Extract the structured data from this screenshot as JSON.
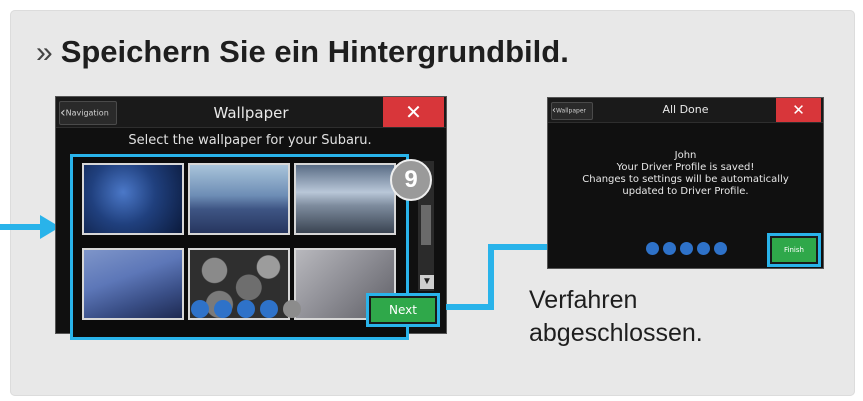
{
  "heading": {
    "chevron": "»",
    "text": "Speichern Sie ein Hintergrundbild."
  },
  "wallpaper_screen": {
    "back_label": "Navigation",
    "title": "Wallpaper",
    "close_label": "✕",
    "subtitle": "Select the wallpaper for your Subaru.",
    "thumbnails": [
      "starry-night",
      "blue-mountains",
      "ocean-rocks",
      "aurora",
      "pebbles",
      "silver-texture"
    ],
    "step_number": "9",
    "scroll_down_icon": "triangle-down-icon",
    "progress_dots": [
      true,
      true,
      true,
      true,
      false
    ],
    "next_label": "Next"
  },
  "done_screen": {
    "back_label": "Wallpaper",
    "title": "All Done",
    "close_label": "✕",
    "message_line1": "John",
    "message_line2": "Your Driver Profile is saved!",
    "message_line3": "Changes to settings will be automatically",
    "message_line4": "updated to Driver Profile.",
    "finish_label": "Finish"
  },
  "caption": {
    "line1": "Verfahren",
    "line2": "abgeschlossen."
  },
  "colors": {
    "highlight": "#29b3ea",
    "close": "#d8363a",
    "button": "#2fa84a",
    "dot_active": "#2e72c9"
  }
}
